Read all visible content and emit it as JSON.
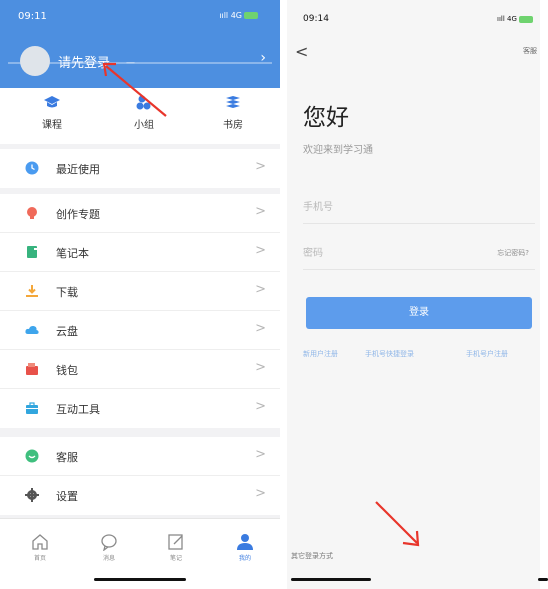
{
  "left": {
    "status": {
      "time": "09:11",
      "signal": "ııll 4G"
    },
    "header": {
      "login_text": "请先登录",
      "dash_text": "—",
      "chevron": "›"
    },
    "tabs": [
      {
        "label": "课程",
        "icon": "graduation-cap-icon"
      },
      {
        "label": "小组",
        "icon": "group-icon"
      },
      {
        "label": "书房",
        "icon": "books-icon"
      }
    ],
    "menu_groups": [
      [
        {
          "label": "最近使用",
          "icon": "clock-icon",
          "color": "#4a9bf0"
        }
      ],
      [
        {
          "label": "创作专题",
          "icon": "lightbulb-icon",
          "color": "#f06a5a"
        },
        {
          "label": "笔记本",
          "icon": "notebook-icon",
          "color": "#37b37e"
        },
        {
          "label": "下载",
          "icon": "download-icon",
          "color": "#f4a73a"
        },
        {
          "label": "云盘",
          "icon": "cloud-icon",
          "color": "#3ea5ec"
        },
        {
          "label": "钱包",
          "icon": "wallet-icon",
          "color": "#e8524a"
        },
        {
          "label": "互动工具",
          "icon": "toolbox-icon",
          "color": "#32a6de"
        }
      ],
      [
        {
          "label": "客服",
          "icon": "chat-icon",
          "color": "#3fbf7e"
        },
        {
          "label": "设置",
          "icon": "gear-icon",
          "color": "#555555"
        }
      ]
    ],
    "arrow_glyph": ">",
    "tabbar": [
      {
        "label": "首页",
        "icon": "home-icon"
      },
      {
        "label": "消息",
        "icon": "message-icon"
      },
      {
        "label": "笔记",
        "icon": "note-edit-icon"
      },
      {
        "label": "我的",
        "icon": "profile-icon",
        "active": true
      }
    ]
  },
  "right": {
    "status": {
      "time": "09:14",
      "signal": "ııll 4G"
    },
    "back": "<",
    "service": "客服",
    "title": "您好",
    "subtitle": "欢迎来到学习通",
    "phone_placeholder": "手机号",
    "password_placeholder": "密码",
    "forgot": "忘记密码?",
    "login_button": "登录",
    "links": [
      "新用户注册",
      "手机号快捷登录",
      "手机号户注册"
    ],
    "other_login": "其它登录方式"
  },
  "colors": {
    "header_blue": "#4d8fe0",
    "button_blue": "#5d9cec",
    "annotation_red": "#e8352b"
  }
}
